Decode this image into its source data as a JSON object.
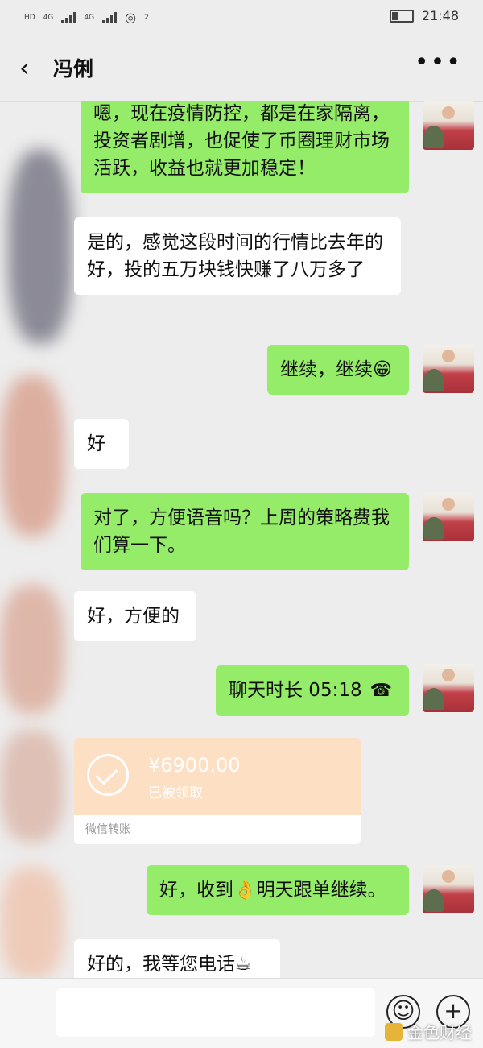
{
  "status_bar": {
    "hd_label": "HD",
    "network_1": "4G",
    "network_2": "4G",
    "hotspot_count": "2",
    "time": "21:48"
  },
  "header": {
    "back_icon": "chevron-left-icon",
    "contact_name": "冯俐",
    "more_icon": "more-dots-icon",
    "more_label": "•••"
  },
  "messages": [
    {
      "side": "me",
      "text": "嗯，现在疫情防控，都是在家隔离，投资者剧增，也促使了币圈理财市场活跃，收益也就更加稳定！"
    },
    {
      "side": "other",
      "text": "是的，感觉这段时间的行情比去年的好，投的五万块钱快赚了八万多了"
    },
    {
      "side": "me",
      "text": "继续，继续😁"
    },
    {
      "side": "other",
      "text": "好"
    },
    {
      "side": "me",
      "text": "对了，方便语音吗？上周的策略费我们算一下。"
    },
    {
      "side": "other",
      "text": "好，方便的"
    },
    {
      "side": "me",
      "text": "聊天时长 05:18",
      "call_icon": "☎"
    },
    {
      "side": "me",
      "text": "好，收到👌明天跟单继续。"
    },
    {
      "side": "other",
      "text": "好的，我等您电话☕"
    }
  ],
  "transfer": {
    "amount": "¥6900.00",
    "status": "已被领取",
    "footer": "微信转账"
  },
  "input_bar": {
    "emoji_icon": "smiley-icon",
    "emoji_glyph": "☺",
    "plus_icon": "plus-icon",
    "plus_glyph": "+"
  },
  "watermark": "金色财经",
  "colors": {
    "background": "#ededed",
    "my_bubble": "#95ec69",
    "their_bubble": "#ffffff",
    "transfer_card": "#fde0c4"
  }
}
